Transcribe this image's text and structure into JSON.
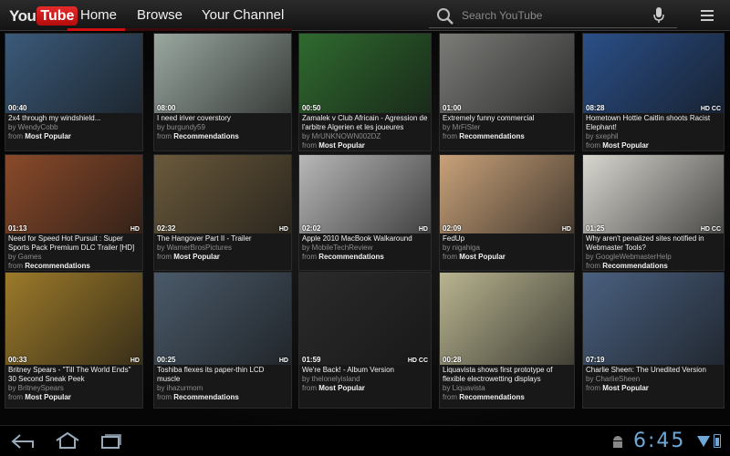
{
  "header": {
    "logo_you": "You",
    "logo_tube": "Tube",
    "tabs": [
      "Home",
      "Browse",
      "Your Channel"
    ],
    "search_placeholder": "Search YouTube"
  },
  "videos": [
    {
      "duration": "00:40",
      "title": "2x4 through my windshield...",
      "by": "by WendyCobb",
      "from_label": "from",
      "from": "Most Popular",
      "badge": ""
    },
    {
      "duration": "08:00",
      "title": "I need iriver coverstory",
      "by": "by burgundy59",
      "from_label": "from",
      "from": "Recommendations",
      "badge": ""
    },
    {
      "duration": "00:50",
      "title": "Zamalek v Club Africain - Agression de l'arbitre Algerien et les joueures",
      "by": "by MrUNKNOWN002DZ",
      "from_label": "from",
      "from": "Most Popular",
      "badge": ""
    },
    {
      "duration": "01:00",
      "title": "Extremely funny commercial",
      "by": "by MrFiSter",
      "from_label": "from",
      "from": "Recommendations",
      "badge": ""
    },
    {
      "duration": "08:28",
      "title": "Hometown Hottie Caitlin shoots Racist Elephant!",
      "by": "by sxephil",
      "from_label": "from",
      "from": "Most Popular",
      "badge": "HD  CC"
    },
    {
      "duration": "01:13",
      "title": "Need for Speed Hot Pursuit : Super Sports Pack Premium DLC Trailer [HD]",
      "by": "by Games",
      "from_label": "from",
      "from": "Recommendations",
      "badge": "HD"
    },
    {
      "duration": "02:32",
      "title": "The Hangover Part II - Trailer",
      "by": "by WarnerBrosPictures",
      "from_label": "from",
      "from": "Most Popular",
      "badge": "HD"
    },
    {
      "duration": "02:02",
      "title": "Apple 2010 MacBook Walkaround",
      "by": "by MobileTechReview",
      "from_label": "from",
      "from": "Recommendations",
      "badge": "HD"
    },
    {
      "duration": "02:09",
      "title": "FedUp",
      "by": "by nigahiga",
      "from_label": "from",
      "from": "Most Popular",
      "badge": "HD"
    },
    {
      "duration": "01:25",
      "title": "Why aren't penalized sites notified in Webmaster Tools?",
      "by": "by GoogleWebmasterHelp",
      "from_label": "from",
      "from": "Recommendations",
      "badge": "HD  CC"
    },
    {
      "duration": "00:33",
      "title": "Britney Spears - \"Till The World Ends\" 30 Second Sneak Peek",
      "by": "by BritneySpears",
      "from_label": "from",
      "from": "Most Popular",
      "badge": "HD"
    },
    {
      "duration": "00:25",
      "title": "Toshiba flexes its paper-thin LCD muscle",
      "by": "by ihazurmom",
      "from_label": "from",
      "from": "Recommendations",
      "badge": "HD"
    },
    {
      "duration": "01:59",
      "title": "We're Back! - Album Version",
      "by": "by thelonelyisland",
      "from_label": "from",
      "from": "Most Popular",
      "badge": "HD  CC"
    },
    {
      "duration": "00:28",
      "title": "Liquavista shows first prototype of flexible electrowetting displays",
      "by": "by Liquavista",
      "from_label": "from",
      "from": "Recommendations",
      "badge": ""
    },
    {
      "duration": "07:19",
      "title": "Charlie Sheen: The Unedited Version",
      "by": "by CharlieSheen",
      "from_label": "from",
      "from": "Most Popular",
      "badge": ""
    }
  ],
  "thumb_colors": [
    "#3b5a7a",
    "#9aa8a0",
    "#2f6a2f",
    "#7b7b78",
    "#2a4f88",
    "#8a4a2a",
    "#6b5a3c",
    "#b8b8b8",
    "#c9a27a",
    "#d8d6cf",
    "#9c7a2a",
    "#4a5a6a",
    "#2b2b2b",
    "#b8b490",
    "#4a6080"
  ],
  "statusbar": {
    "time": "6:45"
  },
  "colors": {
    "accent": "#d01010",
    "status": "#6fa8d6"
  }
}
